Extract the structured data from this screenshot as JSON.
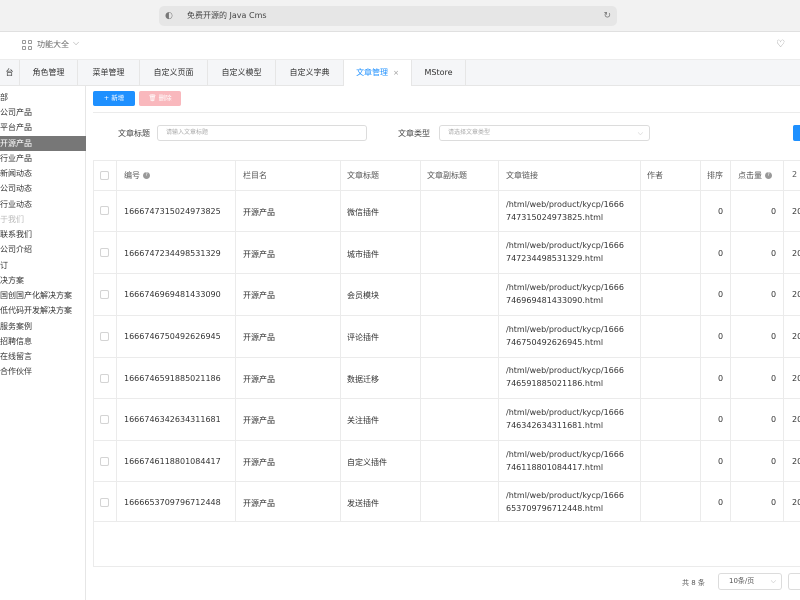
{
  "browser": {
    "url_text": "免费开源的 Java Cms",
    "lead_icon": "reader-icon",
    "reload_icon": "reload-icon"
  },
  "topbar": {
    "function_label": "功能大全"
  },
  "tabs": [
    {
      "label": "台",
      "active": false
    },
    {
      "label": "角色管理",
      "active": false
    },
    {
      "label": "菜单管理",
      "active": false
    },
    {
      "label": "自定义页面",
      "active": false
    },
    {
      "label": "自定义模型",
      "active": false
    },
    {
      "label": "自定义字典",
      "active": false
    },
    {
      "label": "文章管理",
      "active": true,
      "close": "×"
    },
    {
      "label": "MStore",
      "active": false
    }
  ],
  "sidebar": {
    "items": [
      {
        "label": "部"
      },
      {
        "label": "公司产品"
      },
      {
        "label": "平台产品"
      },
      {
        "label": "开源产品",
        "active": true
      },
      {
        "label": "行业产品"
      },
      {
        "label": "新闻动态"
      },
      {
        "label": "公司动态"
      },
      {
        "label": "行业动态"
      },
      {
        "label": "于我们",
        "muted": true
      },
      {
        "label": "联系我们"
      },
      {
        "label": "公司介绍"
      },
      {
        "label": "订"
      },
      {
        "label": "决方案"
      },
      {
        "label": "国创国产化解决方案"
      },
      {
        "label": "低代码开发解决方案"
      },
      {
        "label": "服务案例"
      },
      {
        "label": "招聘信息"
      },
      {
        "label": "在线留言"
      },
      {
        "label": "合作伙伴"
      }
    ]
  },
  "toolbar": {
    "add_label": "+ 新增",
    "delete_label": "🗑 删除"
  },
  "filters": {
    "title_label": "文章标题",
    "title_placeholder": "请输入文章标题",
    "type_label": "文章类型",
    "type_placeholder": "请选择文章类型"
  },
  "table": {
    "headers": {
      "id": "编号",
      "column": "栏目名",
      "title": "文章标题",
      "subtitle": "文章副标题",
      "link": "文章链接",
      "author": "作者",
      "sort": "排序",
      "hits": "点击量",
      "date_partial": "2"
    },
    "rows": [
      {
        "id": "1666747315024973825",
        "column": "开源产品",
        "title": "微信插件",
        "link1": "/html/web/product/kycp/1666",
        "link2": "747315024973825.html",
        "sort": "0",
        "hits": "0",
        "date_partial": "20"
      },
      {
        "id": "1666747234498531329",
        "column": "开源产品",
        "title": "城市插件",
        "link1": "/html/web/product/kycp/1666",
        "link2": "747234498531329.html",
        "sort": "0",
        "hits": "0",
        "date_partial": "20"
      },
      {
        "id": "1666746969481433090",
        "column": "开源产品",
        "title": "会员模块",
        "link1": "/html/web/product/kycp/1666",
        "link2": "746969481433090.html",
        "sort": "0",
        "hits": "0",
        "date_partial": "20"
      },
      {
        "id": "1666746750492626945",
        "column": "开源产品",
        "title": "评论插件",
        "link1": "/html/web/product/kycp/1666",
        "link2": "746750492626945.html",
        "sort": "0",
        "hits": "0",
        "date_partial": "20"
      },
      {
        "id": "1666746591885021186",
        "column": "开源产品",
        "title": "数据迁移",
        "link1": "/html/web/product/kycp/1666",
        "link2": "746591885021186.html",
        "sort": "0",
        "hits": "0",
        "date_partial": "20"
      },
      {
        "id": "1666746342634311681",
        "column": "开源产品",
        "title": "关注插件",
        "link1": "/html/web/product/kycp/1666",
        "link2": "746342634311681.html",
        "sort": "0",
        "hits": "0",
        "date_partial": "20"
      },
      {
        "id": "1666746118801084417",
        "column": "开源产品",
        "title": "自定义插件",
        "link1": "/html/web/product/kycp/1666",
        "link2": "746118801084417.html",
        "sort": "0",
        "hits": "0",
        "date_partial": "20"
      },
      {
        "id": "1666653709796712448",
        "column": "开源产品",
        "title": "发送插件",
        "link1": "/html/web/product/kycp/1666",
        "link2": "653709796712448.html",
        "sort": "0",
        "hits": "0",
        "date_partial": "20"
      }
    ]
  },
  "pagination": {
    "total_text": "共 8 条",
    "page_size": "10条/页"
  },
  "colors": {
    "accent": "#1e90ff",
    "danger_light": "#f9b8bd",
    "sidebar_active": "#777777"
  }
}
